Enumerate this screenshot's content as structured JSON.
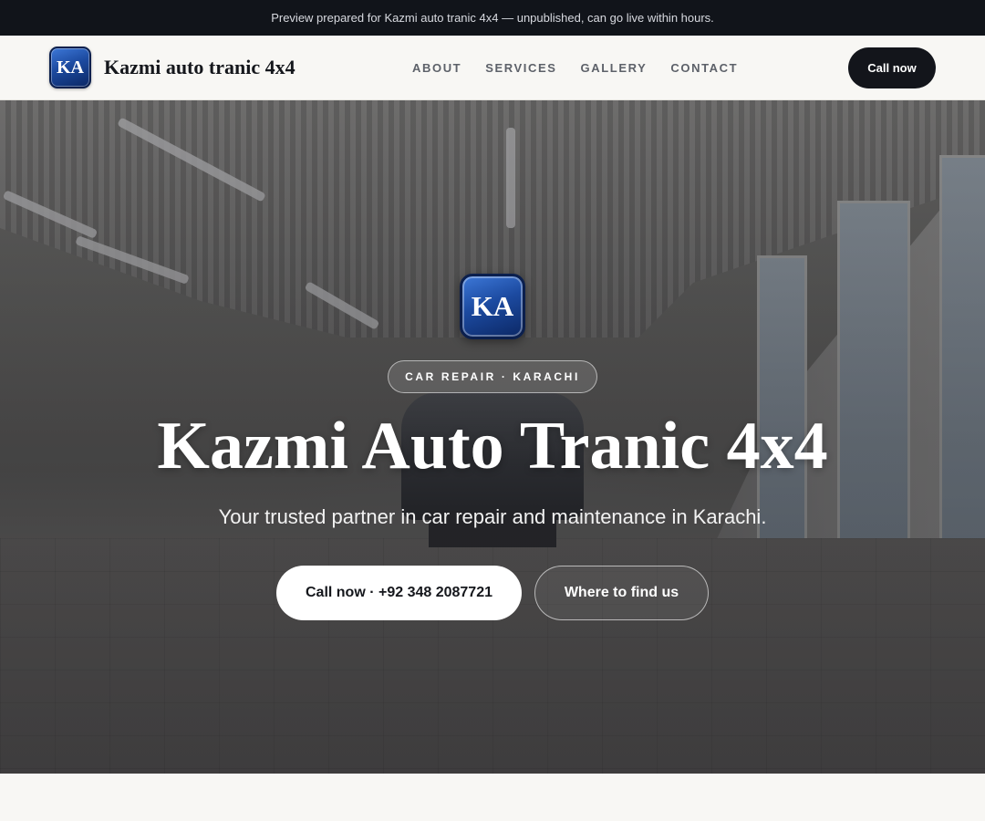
{
  "preview_banner": {
    "text": "Preview prepared for Kazmi auto tranic 4x4 — unpublished, can go live within hours."
  },
  "header": {
    "logo_initials": "KA",
    "brand_name": "Kazmi auto tranic 4x4",
    "nav": [
      {
        "label": "ABOUT"
      },
      {
        "label": "SERVICES"
      },
      {
        "label": "GALLERY"
      },
      {
        "label": "CONTACT"
      }
    ],
    "cta_label": "Call now"
  },
  "hero": {
    "logo_initials": "KA",
    "tagline": "CAR REPAIR · KARACHI",
    "title": "Kazmi Auto Tranic 4x4",
    "subtitle": "Your trusted partner in car repair and maintenance in Karachi.",
    "primary_button": "Call now · +92 348 2087721",
    "secondary_button": "Where to find us"
  },
  "colors": {
    "banner_bg": "#11141a",
    "header_bg": "#f8f7f4",
    "accent_dark": "#13151b",
    "logo_blue": "#1c4aa0"
  }
}
